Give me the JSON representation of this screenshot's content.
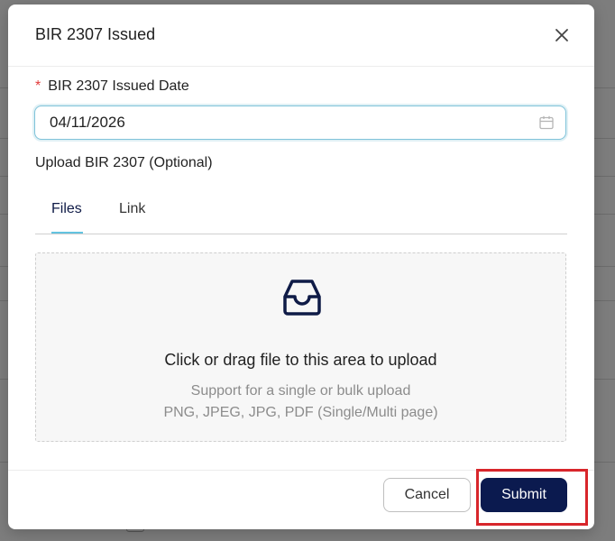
{
  "modal": {
    "title": "BIR 2307 Issued",
    "close_icon": "close-icon"
  },
  "form": {
    "date_label": "BIR 2307 Issued Date",
    "required_mark": "*",
    "date_value": "04/11/2026",
    "calendar_icon": "calendar-icon",
    "upload_label": "Upload BIR 2307 (Optional)"
  },
  "tabs": [
    {
      "label": "Files",
      "active": true
    },
    {
      "label": "Link",
      "active": false
    }
  ],
  "dropzone": {
    "icon": "inbox-icon",
    "title": "Click or drag file to this area to upload",
    "hint_line1": "Support for a single or bulk upload",
    "hint_line2": "PNG, JPEG, JPG, PDF (Single/Multi page)"
  },
  "footer": {
    "cancel_label": "Cancel",
    "submit_label": "Submit"
  },
  "colors": {
    "primary": "#0b1a4f",
    "tab_ink": "#63c3e0",
    "required": "#e23b3b",
    "highlight": "#d8262b"
  }
}
